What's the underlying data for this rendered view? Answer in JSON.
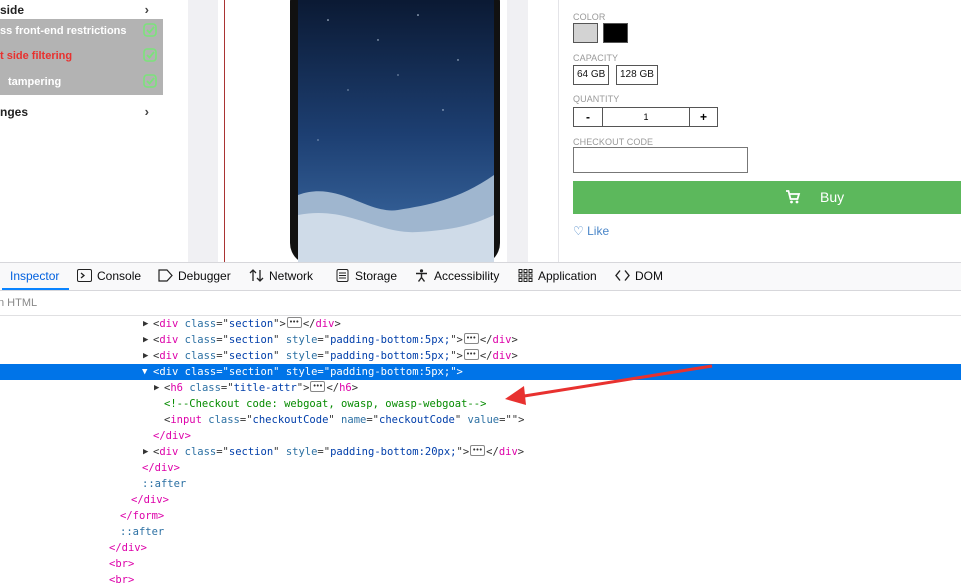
{
  "sidebar": {
    "items": [
      {
        "label": "side",
        "chevron": "›"
      },
      {
        "label": "nges",
        "chevron": "›"
      }
    ],
    "submenu": [
      {
        "label": "ss front-end restrictions",
        "active": false
      },
      {
        "label": "t side filtering",
        "active": true
      },
      {
        "label": "tampering",
        "active": false
      }
    ]
  },
  "product": {
    "color_label": "COLOR",
    "colors": [
      "#d3d3d3",
      "#000000"
    ],
    "capacity_label": "CAPACITY",
    "capacities": [
      "64 GB",
      "128 GB"
    ],
    "quantity_label": "QUANTITY",
    "qty_minus": "-",
    "qty_value": "1",
    "qty_plus": "+",
    "checkout_label": "CHECKOUT CODE",
    "buy_label": "Buy",
    "like_label": "Like",
    "buy_color": "#5cb85c"
  },
  "devtools": {
    "tabs": [
      {
        "label": "Inspector",
        "icon": "inspector-icon",
        "active": true
      },
      {
        "label": "Console",
        "icon": "console-icon"
      },
      {
        "label": "Debugger",
        "icon": "debugger-icon"
      },
      {
        "label": "Network",
        "icon": "network-icon"
      },
      {
        "label": "Storage",
        "icon": "storage-icon"
      },
      {
        "label": "Accessibility",
        "icon": "accessibility-icon"
      },
      {
        "label": "Application",
        "icon": "application-icon"
      },
      {
        "label": "DOM",
        "icon": "dom-icon"
      }
    ],
    "search_placeholder": "n HTML",
    "selection_color": "#0074e8",
    "tree": {
      "r1": {
        "tag": "div",
        "attr": "class",
        "val": "section"
      },
      "r2": {
        "tag": "div",
        "attr": "class",
        "val": "section",
        "attr2": "style",
        "val2": "padding-bottom:5px;"
      },
      "r3": {
        "tag": "div",
        "attr": "class",
        "val": "section",
        "attr2": "style",
        "val2": "padding-bottom:5px;"
      },
      "r4": {
        "tag": "div",
        "attr": "class",
        "val": "section",
        "attr2": "style",
        "val2": "padding-bottom:5px;"
      },
      "r5": {
        "tag": "h6",
        "attr": "class",
        "val": "title-attr"
      },
      "r6": {
        "comment": "<!--Checkout code: webgoat, owasp, owasp-webgoat-->"
      },
      "r7": {
        "tag": "input",
        "attr": "class",
        "val": "checkoutCode",
        "attr2": "name",
        "val2": "checkoutCode",
        "attr3": "value",
        "val3": ""
      },
      "r8": {
        "close": "</div>"
      },
      "r9": {
        "tag": "div",
        "attr": "class",
        "val": "section",
        "attr2": "style",
        "val2": "padding-bottom:20px;"
      },
      "r10": {
        "close": "</div>"
      },
      "r11": {
        "pseudo": "::after"
      },
      "r12": {
        "close": "</div>"
      },
      "r13": {
        "close": "</form>"
      },
      "r14": {
        "pseudo": "::after"
      },
      "r15": {
        "close": "</div>"
      },
      "r16": {
        "tag": "<br>"
      },
      "r17": {
        "tag": "<br>"
      }
    }
  },
  "annotation_arrow_color": "#e8312f"
}
